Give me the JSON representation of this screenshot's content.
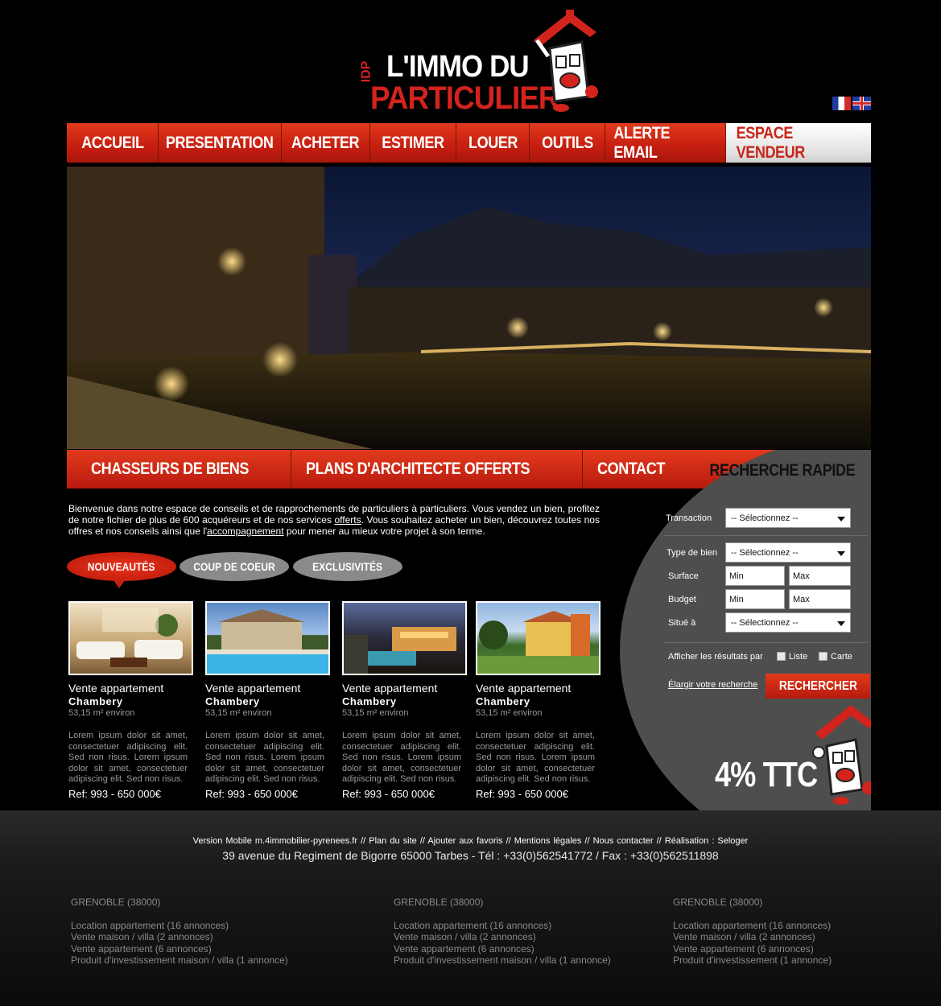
{
  "logo": {
    "line1": "L'IMMO DU",
    "line2": "PARTICULIER",
    "prefix": "IDP"
  },
  "languages": [
    "fr",
    "en"
  ],
  "nav": [
    "ACCUEIL",
    "PRESENTATION",
    "ACHETER",
    "ESTIMER",
    "LOUER",
    "OUTILS",
    "ALERTE EMAIL",
    "ESPACE VENDEUR"
  ],
  "subnav": [
    "CHASSEURS DE BIENS",
    "PLANS D'ARCHITECTE OFFERTS",
    "CONTACT"
  ],
  "quick_search": {
    "title": "RECHERCHE RAPIDE",
    "transaction_label": "Transaction",
    "transaction_value": "-- Sélectionnez --",
    "type_label": "Type de bien",
    "type_value": "-- Sélectionnez --",
    "surface_label": "Surface",
    "budget_label": "Budget",
    "min_placeholder": "Min",
    "max_placeholder": "Max",
    "location_label": "Situé à",
    "location_value": "-- Sélectionnez --",
    "display_label": "Afficher les résultats par",
    "list_label": "Liste",
    "map_label": "Carte",
    "widen_link": "Élargir votre recherche",
    "search_button": "RECHERCHER"
  },
  "promo": "4% TTC",
  "intro": {
    "part1": "Bienvenue dans notre espace de conseils et de rapprochements de particuliers à particuliers. Vous vendez un bien, profitez de notre fichier de plus de 600 acquéreurs et de nos services ",
    "link1": "offerts",
    "part2": ". Vous souhaitez acheter un bien, découvrez toutes nos offres et nos conseils ainsi que l'",
    "link2": "accompagnement",
    "part3": " pour mener au mieux votre projet à son terme."
  },
  "tabs": [
    "NOUVEAUTÉS",
    "COUP DE COEUR",
    "EXCLUSIVITÉS"
  ],
  "listings": [
    {
      "type": "Vente appartement",
      "city": "Chambery",
      "area": "53,15 m² environ",
      "desc": "Lorem ipsum dolor sit amet, consectetuer adipiscing elit. Sed non risus. Lorem ipsum dolor sit amet, consectetuer adipiscing elit. Sed non risus.",
      "ref": "Ref: 993 - 650 000€"
    },
    {
      "type": "Vente appartement",
      "city": "Chambery",
      "area": "53,15 m² environ",
      "desc": "Lorem ipsum dolor sit amet, consectetuer adipiscing elit. Sed non risus. Lorem ipsum dolor sit amet, consectetuer adipiscing elit. Sed non risus.",
      "ref": "Ref: 993 - 650 000€"
    },
    {
      "type": "Vente appartement",
      "city": "Chambery",
      "area": "53,15 m² environ",
      "desc": "Lorem ipsum dolor sit amet, consectetuer adipiscing elit. Sed non risus. Lorem ipsum dolor sit amet, consectetuer adipiscing elit. Sed non risus.",
      "ref": "Ref: 993 - 650 000€"
    },
    {
      "type": "Vente appartement",
      "city": "Chambery",
      "area": "53,15 m² environ",
      "desc": "Lorem ipsum dolor sit amet, consectetuer adipiscing elit. Sed non risus. Lorem ipsum dolor sit amet, consectetuer adipiscing elit. Sed non risus.",
      "ref": "Ref: 993 - 650 000€"
    }
  ],
  "footer": {
    "links": [
      "Version Mobile m.4immobilier-pyrenees.fr",
      "Plan du site",
      "Ajouter aux favoris",
      "Mentions légales",
      "Nous contacter",
      "Réalisation : Seloger"
    ],
    "separator": "//",
    "address": "39 avenue du Regiment de Bigorre 65000 Tarbes - Tél : +33(0)562541772 / Fax : +33(0)562511898",
    "columns": [
      {
        "heading": "GRENOBLE (38000)",
        "items": [
          "Location appartement (16 annonces)",
          "Vente maison / villa (2 annonces)",
          "Vente appartement (6 annonces)",
          "Produit d'investissement maison / villa (1 annonce)"
        ]
      },
      {
        "heading": "GRENOBLE (38000)",
        "items": [
          "Location appartement (16 annonces)",
          "Vente maison / villa (2 annonces)",
          "Vente appartement (6 annonces)",
          "Produit d'investissement maison / villa (1 annonce)"
        ]
      },
      {
        "heading": "GRENOBLE (38000)",
        "items": [
          "Location appartement (16 annonces)",
          "Vente maison / villa (2 annonces)",
          "Vente appartement (6 annonces)",
          "Produit d'investissement (1 annonce)"
        ]
      }
    ]
  },
  "colors": {
    "brand_red": "#d2231d",
    "background": "#000000",
    "panel_gray": "#4e4e4e"
  }
}
